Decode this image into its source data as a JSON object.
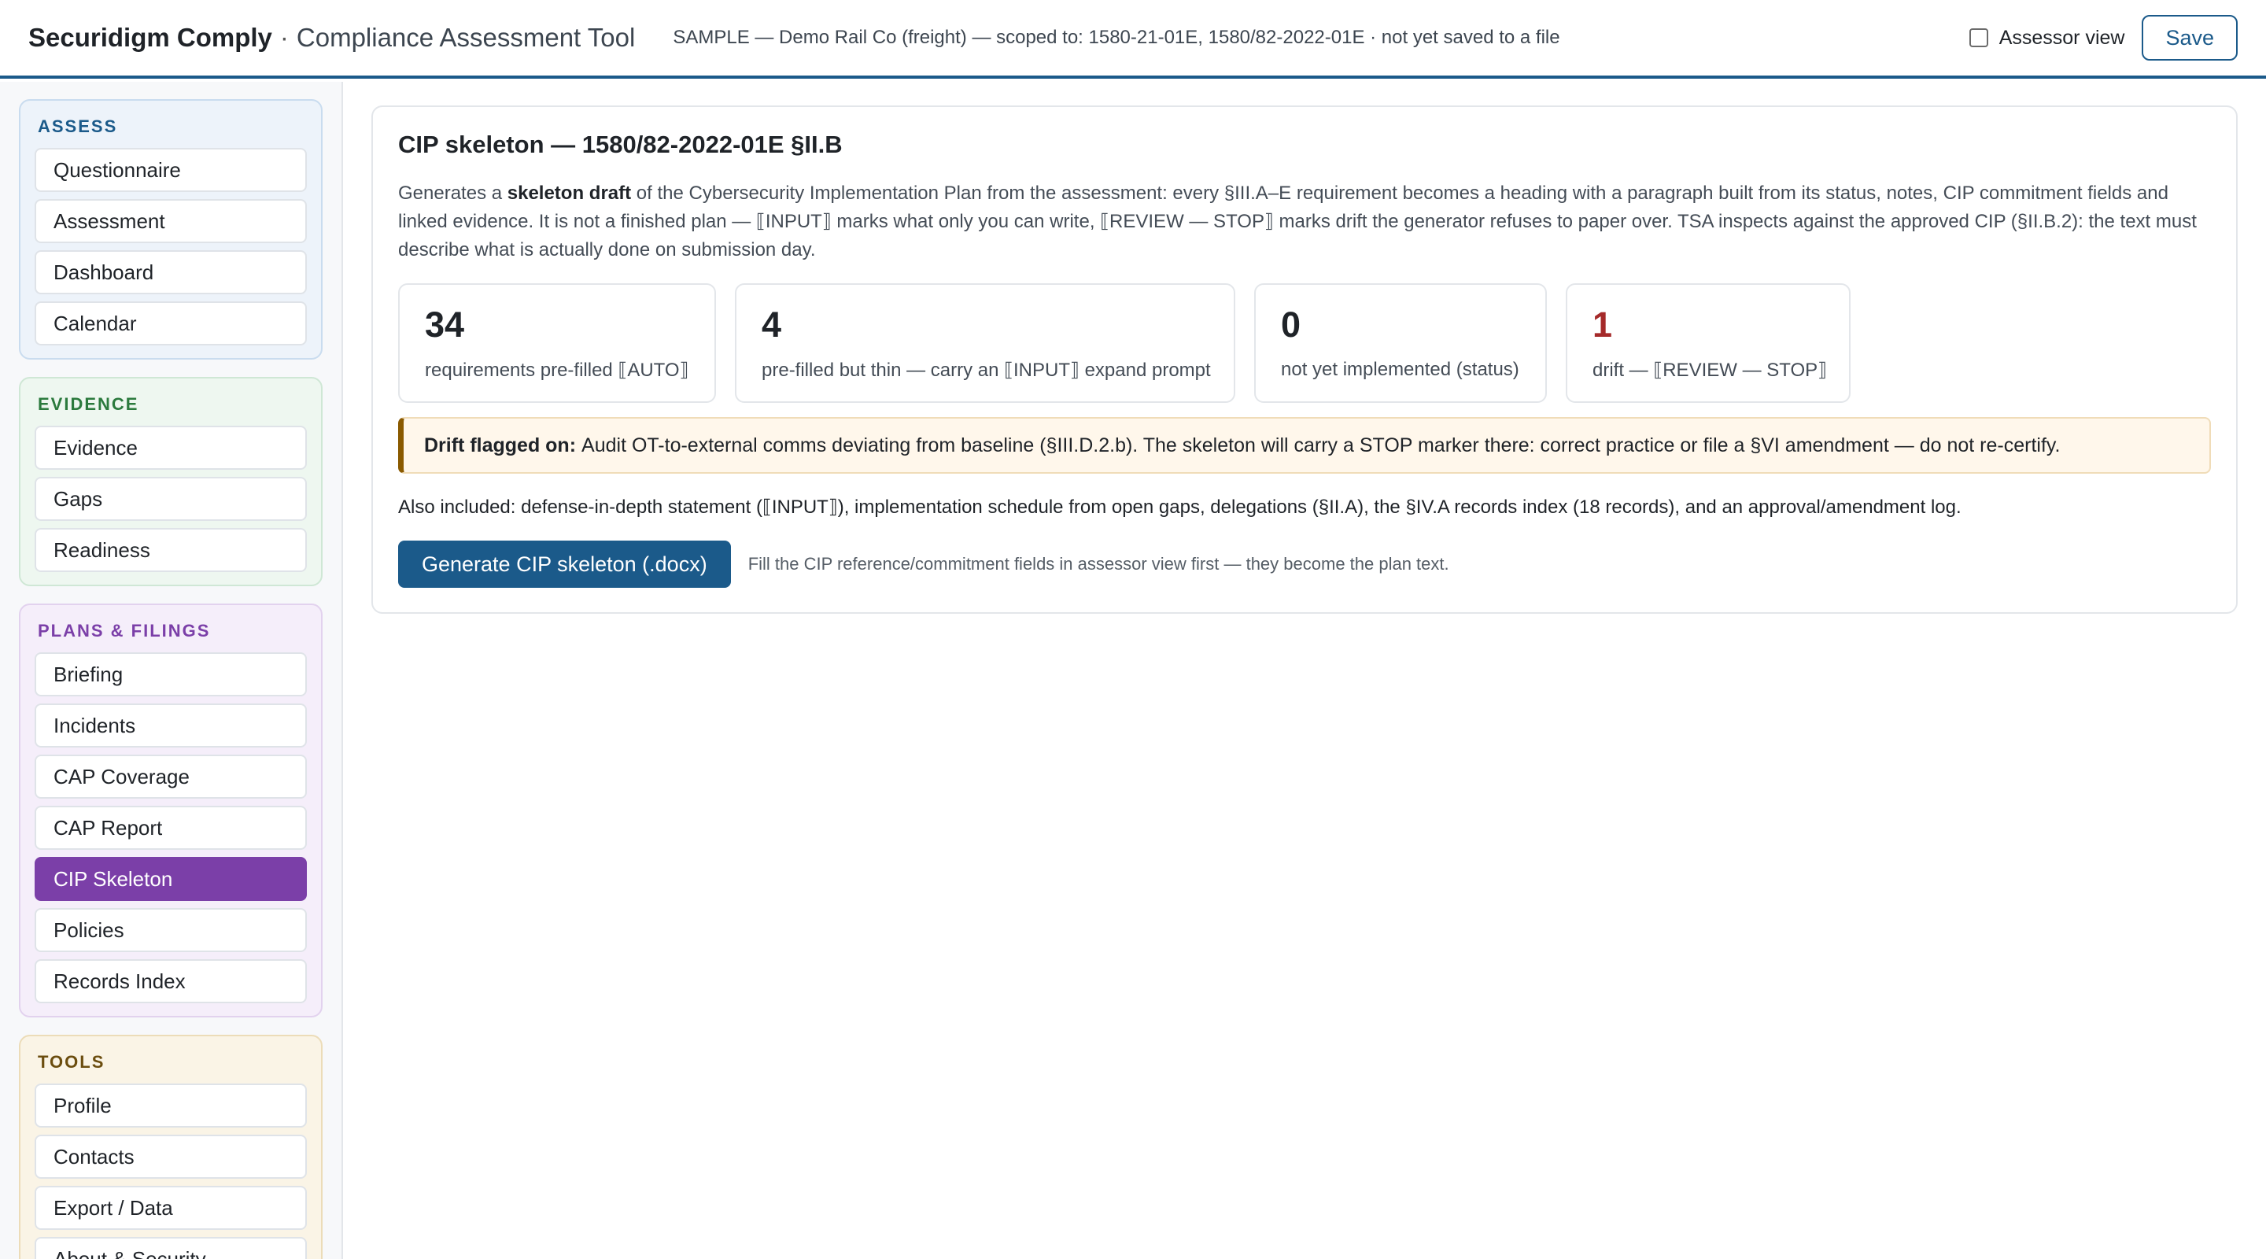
{
  "header": {
    "brand": "Securidigm Comply",
    "separator": "·",
    "subtitle": "Compliance Assessment Tool",
    "context": "SAMPLE — Demo Rail Co (freight) — scoped to: 1580-21-01E, 1580/82-2022-01E · not yet saved to a file",
    "assessor_view_label": "Assessor view",
    "save_label": "Save"
  },
  "sidebar": {
    "assess": {
      "title": "ASSESS",
      "items": [
        "Questionnaire",
        "Assessment",
        "Dashboard",
        "Calendar"
      ]
    },
    "evidence": {
      "title": "EVIDENCE",
      "items": [
        "Evidence",
        "Gaps",
        "Readiness"
      ]
    },
    "plans": {
      "title": "PLANS & FILINGS",
      "items": [
        "Briefing",
        "Incidents",
        "CAP Coverage",
        "CAP Report",
        "CIP Skeleton",
        "Policies",
        "Records Index"
      ],
      "active": "CIP Skeleton"
    },
    "tools": {
      "title": "TOOLS",
      "items": [
        "Profile",
        "Contacts",
        "Export / Data",
        "About & Security"
      ]
    }
  },
  "main": {
    "title": "CIP skeleton — 1580/82-2022-01E §II.B",
    "intro_pre": "Generates a ",
    "intro_bold": "skeleton draft",
    "intro_post": " of the Cybersecurity Implementation Plan from the assessment: every §III.A–E requirement becomes a heading with a paragraph built from its status, notes, CIP commitment fields and linked evidence. It is not a finished plan — ⟦INPUT⟧ marks what only you can write, ⟦REVIEW — STOP⟧ marks drift the generator refuses to paper over. TSA inspects against the approved CIP (§II.B.2): the text must describe what is actually done on submission day.",
    "stats": [
      {
        "value": "34",
        "label": "requirements pre-filled ⟦AUTO⟧"
      },
      {
        "value": "4",
        "label": "pre-filled but thin — carry an ⟦INPUT⟧ expand prompt"
      },
      {
        "value": "0",
        "label": "not yet implemented (status)"
      },
      {
        "value": "1",
        "label": "drift — ⟦REVIEW — STOP⟧"
      }
    ],
    "drift_label": "Drift flagged on:",
    "drift_text": "Audit OT-to-external comms deviating from baseline (§III.D.2.b). The skeleton will carry a STOP marker there: correct practice or file a §VI amendment — do not re-certify.",
    "also_included": "Also included: defense-in-depth statement (⟦INPUT⟧), implementation schedule from open gaps, delegations (§II.A), the §IV.A records index (18 records), and an approval/amendment log.",
    "generate_label": "Generate CIP skeleton (.docx)",
    "hint": "Fill the CIP reference/commitment fields in assessor view first — they become the plan text."
  },
  "colors": {
    "accent": "#1b5a8a",
    "active_nav": "#7b3fa8",
    "drift_stat": "#a52a2a",
    "drift_border": "#8a5a00"
  }
}
